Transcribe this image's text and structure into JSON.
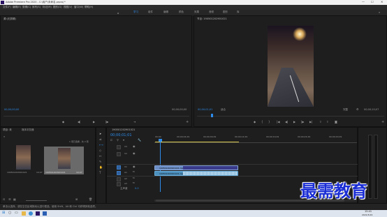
{
  "titlebar": {
    "title": "Adobe Premiere Pro 2020 - C:\\用户\\未命名.prproj *"
  },
  "menu": [
    "文件(F)",
    "编辑(E)",
    "剪辑(C)",
    "序列(S)",
    "标记(M)",
    "图形(G)",
    "视图(V)",
    "窗口(W)",
    "帮助(H)"
  ],
  "workspaces": [
    "学习",
    "组件",
    "编辑",
    "颜色",
    "效果",
    "音频",
    "图形",
    "库"
  ],
  "source": {
    "title": "源:(无剪辑)",
    "timecode_left": "00;00;00;00",
    "timecode_right": "00;00;00;00"
  },
  "program": {
    "title": "节目: 190501202901021",
    "timecode": "00;00;01;01",
    "fit": "适合",
    "quality": "完整",
    "duration": "00;00;10;07"
  },
  "project": {
    "tab1": "项目: 未",
    "tab2": "媒体浏览器",
    "item_count": "1 项已选择，共 2 项",
    "item1_name": "190501202901021",
    "item1_duration": "10;07",
    "item2_name": "190501202901021",
    "item2_duration": "10;07"
  },
  "timeline": {
    "tab": "190501202901021",
    "timecode": "00;00;01;01",
    "ruler": [
      "00;00",
      "00;00;04;29",
      "00;00;09;29",
      "00;00;14;29",
      "00;00;19;29",
      "00;00;24;29",
      "00;00;29;29"
    ],
    "tracks": [
      "V3",
      "V2",
      "V1",
      "A1",
      "A2",
      "A3"
    ],
    "master": "主声道",
    "master_val": "0.0",
    "clip1": "190501202901021.mp4",
    "clip2": "190501202901021.mp4 [V]"
  },
  "status": {
    "text": "单击以选择，或在空白区域拖动以进行框选。使用 Shift、Alt 和 Ctrl 可获得其他选项。"
  },
  "taskbar": {
    "time": "15:41",
    "date": "2021/5/22"
  },
  "watermark": "最需教育",
  "colors": {
    "accent": "#2d8ceb",
    "clip_video": "#6d8fc8",
    "clip_audio": "#4a8fbe"
  }
}
